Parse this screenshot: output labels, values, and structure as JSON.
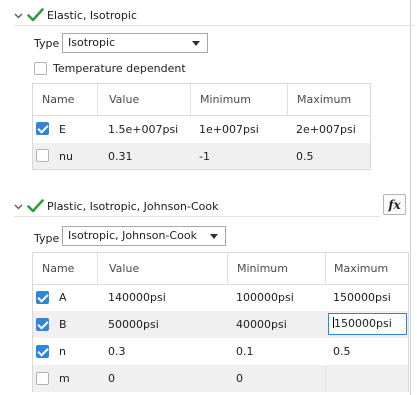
{
  "elastic": {
    "title": "Elastic, Isotropic",
    "type_label": "Type",
    "type_value": "Isotropic",
    "temp_label": "Temperature dependent",
    "columns": [
      "Name",
      "Value",
      "Minimum",
      "Maximum"
    ],
    "rows": [
      {
        "checked": true,
        "name": "E",
        "value": "1.5e+007psi",
        "min": "1e+007psi",
        "max": "2e+007psi"
      },
      {
        "checked": false,
        "name": "nu",
        "value": "0.31",
        "min": "-1",
        "max": "0.5"
      }
    ]
  },
  "plastic": {
    "title": "Plastic, Isotropic, Johnson-Cook",
    "fx_label": "fx",
    "type_label": "Type",
    "type_value": "Isotropic, Johnson-Cook",
    "columns": [
      "Name",
      "Value",
      "Minimum",
      "Maximum"
    ],
    "rows": [
      {
        "checked": true,
        "name": "A",
        "value": "140000psi",
        "min": "100000psi",
        "max": "150000psi"
      },
      {
        "checked": true,
        "name": "B",
        "value": "50000psi",
        "min": "40000psi",
        "max": "150000psi"
      },
      {
        "checked": true,
        "name": "n",
        "value": "0.3",
        "min": "0.1",
        "max": "0.5"
      },
      {
        "checked": false,
        "name": "m",
        "value": "0",
        "min": "0",
        "max": ""
      }
    ]
  },
  "colors": {
    "accent": "#2f86d9",
    "check_green": "#2e9e3a",
    "alt_row": "#f0f0f0"
  },
  "icons": [
    "chevron-down-icon",
    "green-check-icon",
    "fx-icon",
    "dropdown-arrow-icon"
  ]
}
